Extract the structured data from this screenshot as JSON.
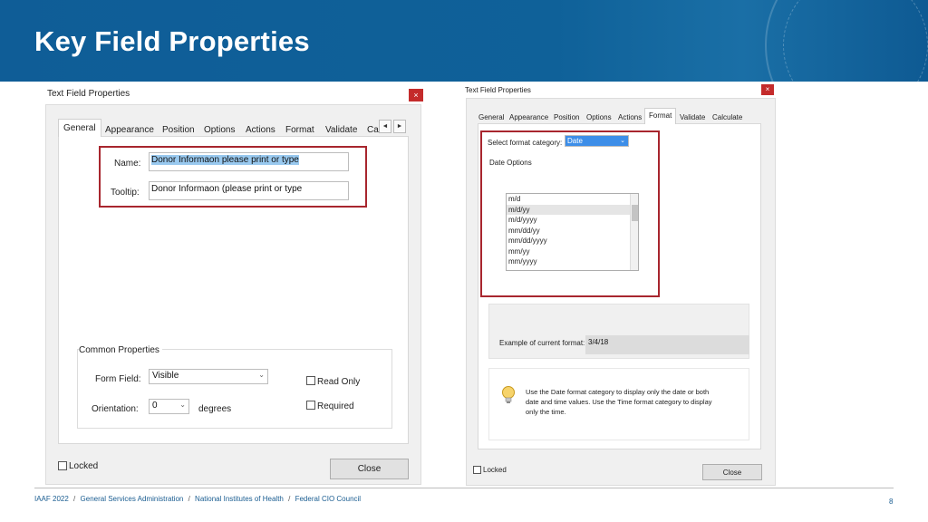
{
  "slide": {
    "title": "Key Field Properties",
    "page_number": "8",
    "footer": [
      "IAAF 2022",
      "General Services Administration",
      "National Institutes of Health",
      "Federal CIO Council"
    ],
    "footer_sep": "/"
  },
  "left_dialog": {
    "title": "Text Field Properties",
    "close": "×",
    "tabs": [
      "General",
      "Appearance",
      "Position",
      "Options",
      "Actions",
      "Format",
      "Validate",
      "Ca"
    ],
    "nav_prev": "◄",
    "nav_next": "►",
    "name_label": "Name:",
    "name_value": "Donor Informaon please print or type",
    "tooltip_label": "Tooltip:",
    "tooltip_value": "Donor Informaon (please print or type",
    "common_properties": "Common Properties",
    "form_field_label": "Form Field:",
    "form_field_value": "Visible",
    "orientation_label": "Orientation:",
    "orientation_value": "0",
    "degrees_label": "degrees",
    "read_only_label": "Read Only",
    "required_label": "Required",
    "locked_label": "Locked",
    "close_button": "Close"
  },
  "right_dialog": {
    "title": "Text Field Properties",
    "close": "×",
    "tabs": [
      "General",
      "Appearance",
      "Position",
      "Options",
      "Actions",
      "Format",
      "Validate",
      "Calculate"
    ],
    "select_category_label": "Select format category:",
    "category_value": "Date",
    "date_options_label": "Date Options",
    "date_formats": [
      "m/d",
      "m/d/yy",
      "m/d/yyyy",
      "mm/dd/yy",
      "mm/dd/yyyy",
      "mm/yy",
      "mm/yyyy"
    ],
    "selected_format_index": 1,
    "example_label": "Example of current format:",
    "example_value": "3/4/18",
    "hint_text": "Use the Date format category to display only the date or both date and time values. Use the Time format category to display only the time.",
    "locked_label": "Locked",
    "close_button": "Close"
  },
  "colors": {
    "header_blue": "#0f5d97",
    "highlight_red": "#a8262e",
    "selection_blue": "#99c9ef"
  },
  "icons": {
    "hint": "lightbulb-icon"
  }
}
